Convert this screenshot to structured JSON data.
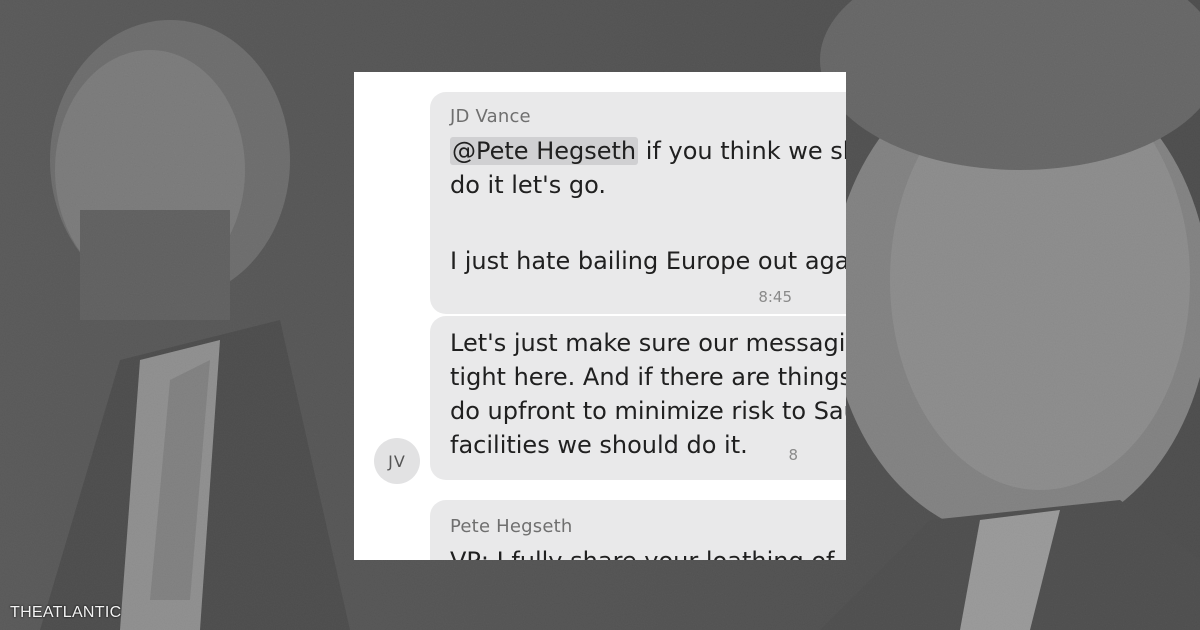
{
  "messages": {
    "jd_vance": {
      "sender": "JD Vance",
      "mention": "@Pete Hegseth",
      "line1_rest": " if you think we sh",
      "line2": "do it let's go.",
      "line3": "I just hate bailing Europe out agai",
      "time": "8:45"
    },
    "jd_vance_2": {
      "line1": "Let's just make sure our messagi",
      "line2": "tight here. And if there are things",
      "line3": "do upfront to minimize risk to Sau",
      "line4": "facilities we should do it.",
      "time": "8"
    },
    "pete_hegseth": {
      "sender": "Pete Hegseth",
      "line1": "VP: I fully share your loathing of"
    }
  },
  "avatar": {
    "initials": "JV"
  },
  "brand": {
    "text": "THEATLANTIC"
  },
  "colors": {
    "bubble": "#e9e9ea",
    "panel": "#ffffff",
    "mention_highlight": "#d0d0d2"
  }
}
